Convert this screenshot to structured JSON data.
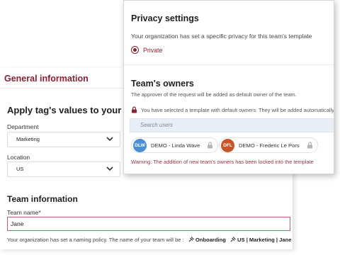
{
  "general": {
    "title": "General information",
    "tags_title": "Apply tag's values to your team",
    "department_label": "Department",
    "department_value": "Marketing",
    "location_label": "Location",
    "location_value": "US",
    "team_info_title": "Team information",
    "team_name_label": "Team name*",
    "team_name_value": "Jane",
    "policy_prefix": "Your organization has set a naming policy. The name of your team will be :",
    "policy_part1": "Onboarding",
    "policy_part2": "US | Marketing | Jane"
  },
  "privacy": {
    "title": "Privacy settings",
    "text": "Your organization has set a specific privacy for this team's template",
    "option": "Private"
  },
  "owners": {
    "title": "Team's owners",
    "text": "The approver of the request will be added as default owner of the team.",
    "lock_notice": "You have selected a template with default owners. They will be added automatically.",
    "search_placeholder": "Search users",
    "chips": [
      {
        "initials": "DLW",
        "name": "DEMO - Linda Wave",
        "color": "#4a8fd6"
      },
      {
        "initials": "DFL",
        "name": "DEMO - Frederic Le Pors",
        "color": "#c8552a"
      }
    ],
    "warning": "Warning: The addition of new team's owners has been locked into the template"
  },
  "colors": {
    "accent": "#8a2030",
    "search_bg": "#e9eef6"
  }
}
